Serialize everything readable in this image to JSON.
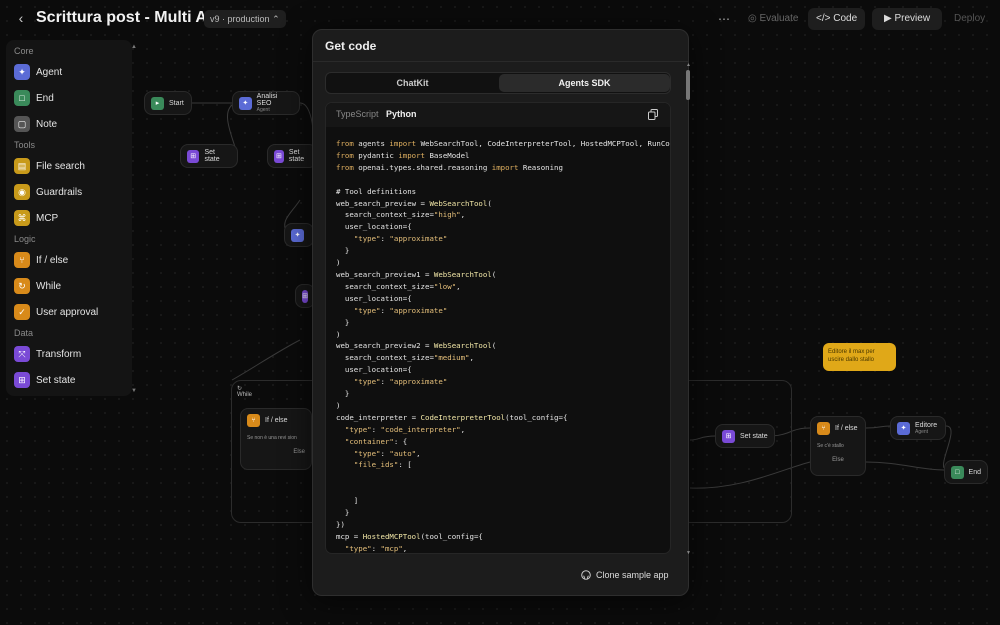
{
  "header": {
    "back_icon": "chevron-left-icon",
    "title": "Scrittura post - Multi Agent",
    "version": "v9 · production",
    "more": "⋯",
    "evaluate": "Evaluate",
    "code": "Code",
    "preview": "Preview",
    "deploy": "Deploy"
  },
  "sidebar": {
    "core_label": "Core",
    "tools_label": "Tools",
    "logic_label": "Logic",
    "data_label": "Data",
    "items": [
      {
        "label": "Agent",
        "icon": "agent-icon",
        "color": "#5b6bd6"
      },
      {
        "label": "End",
        "icon": "end-icon",
        "color": "#3a8a5a"
      },
      {
        "label": "Note",
        "icon": "note-icon",
        "color": "#555555"
      },
      {
        "label": "File search",
        "icon": "file-search-icon",
        "color": "#c89a1a"
      },
      {
        "label": "Guardrails",
        "icon": "guardrails-icon",
        "color": "#c89a1a"
      },
      {
        "label": "MCP",
        "icon": "mcp-icon",
        "color": "#c89a1a"
      },
      {
        "label": "If / else",
        "icon": "if-else-icon",
        "color": "#d88a1a"
      },
      {
        "label": "While",
        "icon": "while-icon",
        "color": "#d88a1a"
      },
      {
        "label": "User approval",
        "icon": "user-approval-icon",
        "color": "#d88a1a"
      },
      {
        "label": "Transform",
        "icon": "transform-icon",
        "color": "#7a4ad6"
      },
      {
        "label": "Set state",
        "icon": "set-state-icon",
        "color": "#7a4ad6"
      }
    ]
  },
  "canvas": {
    "start": "Start",
    "analisi_seo": "Analisi SEO",
    "agent_sub": "Agent",
    "set_state": "Set state",
    "while": "While",
    "if_else": "If / else",
    "if_else_cond": "Se non è una revi sion",
    "else": "Else",
    "if_else_cond2": "Se c'è stallo",
    "editore": "Editore",
    "end": "End",
    "note_text": "Editore il max per uscire dallo stallo"
  },
  "modal": {
    "title": "Get code",
    "tabs": [
      "ChatKit",
      "Agents SDK"
    ],
    "lang_ts": "TypeScript",
    "lang_py": "Python",
    "clone": "Clone sample app"
  }
}
